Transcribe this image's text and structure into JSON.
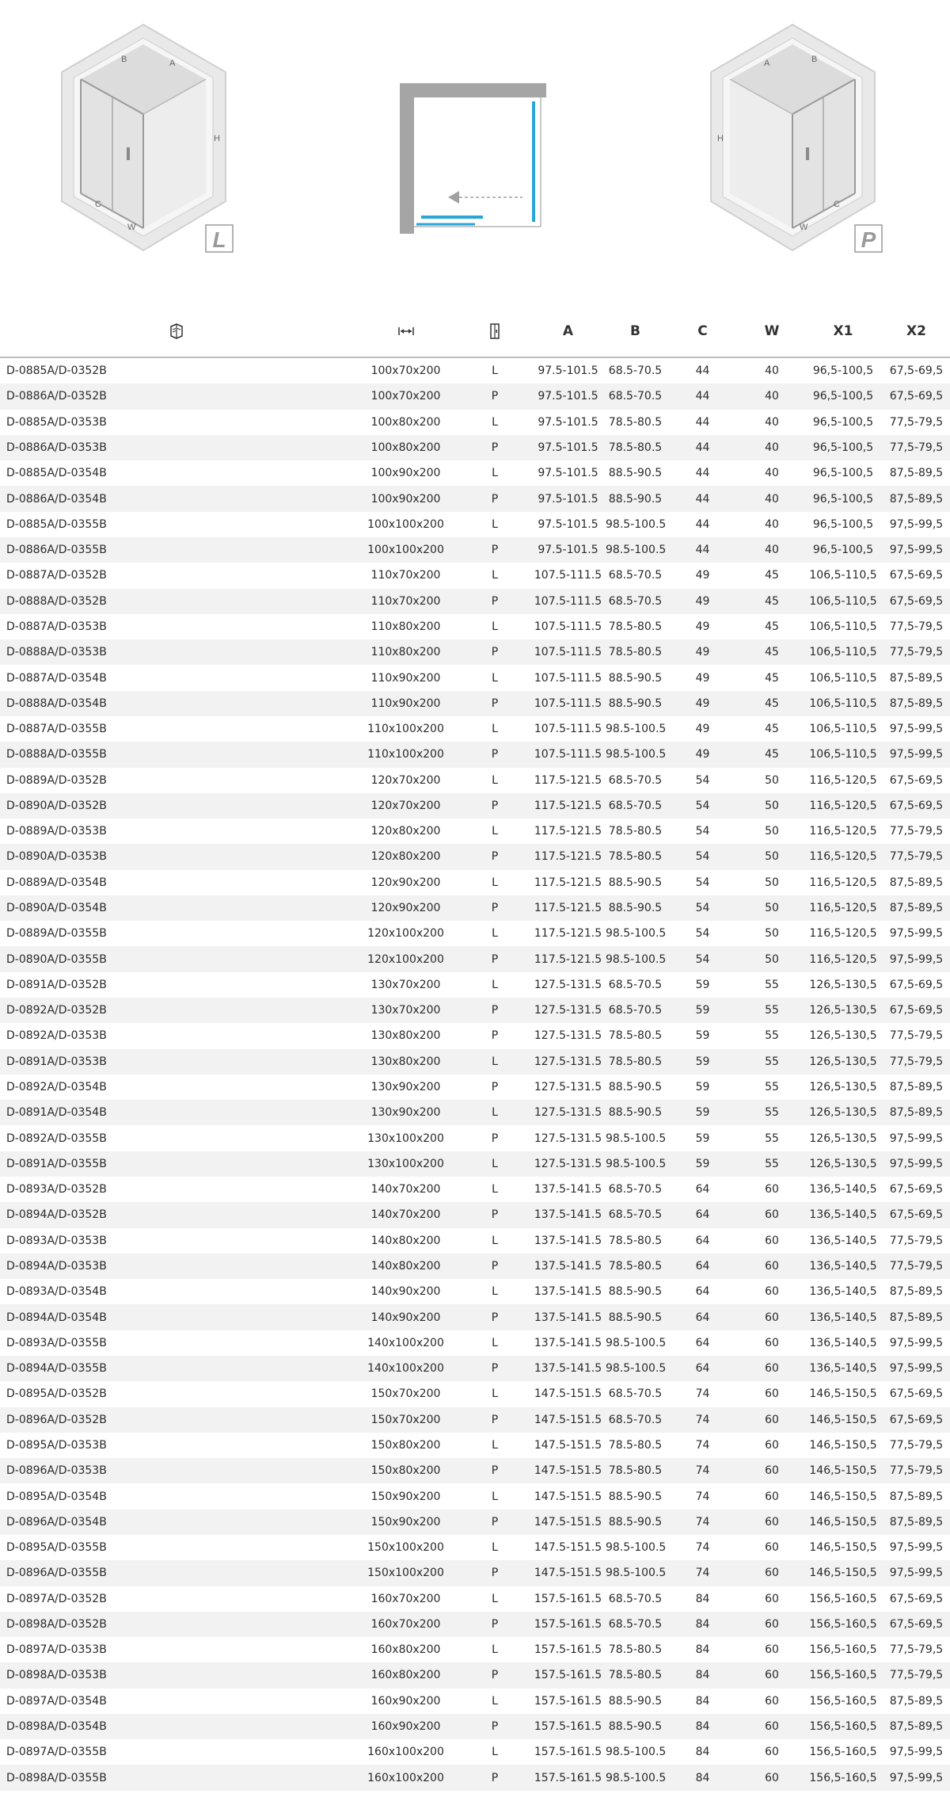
{
  "diagrams": {
    "left": {
      "letter": "L",
      "labels": {
        "a": "A",
        "b": "B",
        "c": "C",
        "w": "W",
        "h": "H"
      }
    },
    "right": {
      "letter": "P",
      "labels": {
        "a": "A",
        "b": "B",
        "c": "C",
        "w": "W",
        "h": "H"
      }
    }
  },
  "table": {
    "icons": {
      "code": "catalog-book-icon",
      "size": "width-arrows-icon",
      "side": "door-icon"
    },
    "headers": {
      "a": "A",
      "b": "B",
      "c": "C",
      "w": "W",
      "x1": "X1",
      "x2": "X2"
    },
    "rows": [
      [
        "D-0885A/D-0352B",
        "100x70x200",
        "L",
        "97.5-101.5",
        "68.5-70.5",
        "44",
        "40",
        "96,5-100,5",
        "67,5-69,5"
      ],
      [
        "D-0886A/D-0352B",
        "100x70x200",
        "P",
        "97.5-101.5",
        "68.5-70.5",
        "44",
        "40",
        "96,5-100,5",
        "67,5-69,5"
      ],
      [
        "D-0885A/D-0353B",
        "100x80x200",
        "L",
        "97.5-101.5",
        "78.5-80.5",
        "44",
        "40",
        "96,5-100,5",
        "77,5-79,5"
      ],
      [
        "D-0886A/D-0353B",
        "100x80x200",
        "P",
        "97.5-101.5",
        "78.5-80.5",
        "44",
        "40",
        "96,5-100,5",
        "77,5-79,5"
      ],
      [
        "D-0885A/D-0354B",
        "100x90x200",
        "L",
        "97.5-101.5",
        "88.5-90.5",
        "44",
        "40",
        "96,5-100,5",
        "87,5-89,5"
      ],
      [
        "D-0886A/D-0354B",
        "100x90x200",
        "P",
        "97.5-101.5",
        "88.5-90.5",
        "44",
        "40",
        "96,5-100,5",
        "87,5-89,5"
      ],
      [
        "D-0885A/D-0355B",
        "100x100x200",
        "L",
        "97.5-101.5",
        "98.5-100.5",
        "44",
        "40",
        "96,5-100,5",
        "97,5-99,5"
      ],
      [
        "D-0886A/D-0355B",
        "100x100x200",
        "P",
        "97.5-101.5",
        "98.5-100.5",
        "44",
        "40",
        "96,5-100,5",
        "97,5-99,5"
      ],
      [
        "D-0887A/D-0352B",
        "110x70x200",
        "L",
        "107.5-111.5",
        "68.5-70.5",
        "49",
        "45",
        "106,5-110,5",
        "67,5-69,5"
      ],
      [
        "D-0888A/D-0352B",
        "110x70x200",
        "P",
        "107.5-111.5",
        "68.5-70.5",
        "49",
        "45",
        "106,5-110,5",
        "67,5-69,5"
      ],
      [
        "D-0887A/D-0353B",
        "110x80x200",
        "L",
        "107.5-111.5",
        "78.5-80.5",
        "49",
        "45",
        "106,5-110,5",
        "77,5-79,5"
      ],
      [
        "D-0888A/D-0353B",
        "110x80x200",
        "P",
        "107.5-111.5",
        "78.5-80.5",
        "49",
        "45",
        "106,5-110,5",
        "77,5-79,5"
      ],
      [
        "D-0887A/D-0354B",
        "110x90x200",
        "L",
        "107.5-111.5",
        "88.5-90.5",
        "49",
        "45",
        "106,5-110,5",
        "87,5-89,5"
      ],
      [
        "D-0888A/D-0354B",
        "110x90x200",
        "P",
        "107.5-111.5",
        "88.5-90.5",
        "49",
        "45",
        "106,5-110,5",
        "87,5-89,5"
      ],
      [
        "D-0887A/D-0355B",
        "110x100x200",
        "L",
        "107.5-111.5",
        "98.5-100.5",
        "49",
        "45",
        "106,5-110,5",
        "97,5-99,5"
      ],
      [
        "D-0888A/D-0355B",
        "110x100x200",
        "P",
        "107.5-111.5",
        "98.5-100.5",
        "49",
        "45",
        "106,5-110,5",
        "97,5-99,5"
      ],
      [
        "D-0889A/D-0352B",
        "120x70x200",
        "L",
        "117.5-121.5",
        "68.5-70.5",
        "54",
        "50",
        "116,5-120,5",
        "67,5-69,5"
      ],
      [
        "D-0890A/D-0352B",
        "120x70x200",
        "P",
        "117.5-121.5",
        "68.5-70.5",
        "54",
        "50",
        "116,5-120,5",
        "67,5-69,5"
      ],
      [
        "D-0889A/D-0353B",
        "120x80x200",
        "L",
        "117.5-121.5",
        "78.5-80.5",
        "54",
        "50",
        "116,5-120,5",
        "77,5-79,5"
      ],
      [
        "D-0890A/D-0353B",
        "120x80x200",
        "P",
        "117.5-121.5",
        "78.5-80.5",
        "54",
        "50",
        "116,5-120,5",
        "77,5-79,5"
      ],
      [
        "D-0889A/D-0354B",
        "120x90x200",
        "L",
        "117.5-121.5",
        "88.5-90.5",
        "54",
        "50",
        "116,5-120,5",
        "87,5-89,5"
      ],
      [
        "D-0890A/D-0354B",
        "120x90x200",
        "P",
        "117.5-121.5",
        "88.5-90.5",
        "54",
        "50",
        "116,5-120,5",
        "87,5-89,5"
      ],
      [
        "D-0889A/D-0355B",
        "120x100x200",
        "L",
        "117.5-121.5",
        "98.5-100.5",
        "54",
        "50",
        "116,5-120,5",
        "97,5-99,5"
      ],
      [
        "D-0890A/D-0355B",
        "120x100x200",
        "P",
        "117.5-121.5",
        "98.5-100.5",
        "54",
        "50",
        "116,5-120,5",
        "97,5-99,5"
      ],
      [
        "D-0891A/D-0352B",
        "130x70x200",
        "L",
        "127.5-131.5",
        "68.5-70.5",
        "59",
        "55",
        "126,5-130,5",
        "67,5-69,5"
      ],
      [
        "D-0892A/D-0352B",
        "130x70x200",
        "P",
        "127.5-131.5",
        "68.5-70.5",
        "59",
        "55",
        "126,5-130,5",
        "67,5-69,5"
      ],
      [
        "D-0892A/D-0353B",
        "130x80x200",
        "P",
        "127.5-131.5",
        "78.5-80.5",
        "59",
        "55",
        "126,5-130,5",
        "77,5-79,5"
      ],
      [
        "D-0891A/D-0353B",
        "130x80x200",
        "L",
        "127.5-131.5",
        "78.5-80.5",
        "59",
        "55",
        "126,5-130,5",
        "77,5-79,5"
      ],
      [
        "D-0892A/D-0354B",
        "130x90x200",
        "P",
        "127.5-131.5",
        "88.5-90.5",
        "59",
        "55",
        "126,5-130,5",
        "87,5-89,5"
      ],
      [
        "D-0891A/D-0354B",
        "130x90x200",
        "L",
        "127.5-131.5",
        "88.5-90.5",
        "59",
        "55",
        "126,5-130,5",
        "87,5-89,5"
      ],
      [
        "D-0892A/D-0355B",
        "130x100x200",
        "P",
        "127.5-131.5",
        "98.5-100.5",
        "59",
        "55",
        "126,5-130,5",
        "97,5-99,5"
      ],
      [
        "D-0891A/D-0355B",
        "130x100x200",
        "L",
        "127.5-131.5",
        "98.5-100.5",
        "59",
        "55",
        "126,5-130,5",
        "97,5-99,5"
      ],
      [
        "D-0893A/D-0352B",
        "140x70x200",
        "L",
        "137.5-141.5",
        "68.5-70.5",
        "64",
        "60",
        "136,5-140,5",
        "67,5-69,5"
      ],
      [
        "D-0894A/D-0352B",
        "140x70x200",
        "P",
        "137.5-141.5",
        "68.5-70.5",
        "64",
        "60",
        "136,5-140,5",
        "67,5-69,5"
      ],
      [
        "D-0893A/D-0353B",
        "140x80x200",
        "L",
        "137.5-141.5",
        "78.5-80.5",
        "64",
        "60",
        "136,5-140,5",
        "77,5-79,5"
      ],
      [
        "D-0894A/D-0353B",
        "140x80x200",
        "P",
        "137.5-141.5",
        "78.5-80.5",
        "64",
        "60",
        "136,5-140,5",
        "77,5-79,5"
      ],
      [
        "D-0893A/D-0354B",
        "140x90x200",
        "L",
        "137.5-141.5",
        "88.5-90.5",
        "64",
        "60",
        "136,5-140,5",
        "87,5-89,5"
      ],
      [
        "D-0894A/D-0354B",
        "140x90x200",
        "P",
        "137.5-141.5",
        "88.5-90.5",
        "64",
        "60",
        "136,5-140,5",
        "87,5-89,5"
      ],
      [
        "D-0893A/D-0355B",
        "140x100x200",
        "L",
        "137.5-141.5",
        "98.5-100.5",
        "64",
        "60",
        "136,5-140,5",
        "97,5-99,5"
      ],
      [
        "D-0894A/D-0355B",
        "140x100x200",
        "P",
        "137.5-141.5",
        "98.5-100.5",
        "64",
        "60",
        "136,5-140,5",
        "97,5-99,5"
      ],
      [
        "D-0895A/D-0352B",
        "150x70x200",
        "L",
        "147.5-151.5",
        "68.5-70.5",
        "74",
        "60",
        "146,5-150,5",
        "67,5-69,5"
      ],
      [
        "D-0896A/D-0352B",
        "150x70x200",
        "P",
        "147.5-151.5",
        "68.5-70.5",
        "74",
        "60",
        "146,5-150,5",
        "67,5-69,5"
      ],
      [
        "D-0895A/D-0353B",
        "150x80x200",
        "L",
        "147.5-151.5",
        "78.5-80.5",
        "74",
        "60",
        "146,5-150,5",
        "77,5-79,5"
      ],
      [
        "D-0896A/D-0353B",
        "150x80x200",
        "P",
        "147.5-151.5",
        "78.5-80.5",
        "74",
        "60",
        "146,5-150,5",
        "77,5-79,5"
      ],
      [
        "D-0895A/D-0354B",
        "150x90x200",
        "L",
        "147.5-151.5",
        "88.5-90.5",
        "74",
        "60",
        "146,5-150,5",
        "87,5-89,5"
      ],
      [
        "D-0896A/D-0354B",
        "150x90x200",
        "P",
        "147.5-151.5",
        "88.5-90.5",
        "74",
        "60",
        "146,5-150,5",
        "87,5-89,5"
      ],
      [
        "D-0895A/D-0355B",
        "150x100x200",
        "L",
        "147.5-151.5",
        "98.5-100.5",
        "74",
        "60",
        "146,5-150,5",
        "97,5-99,5"
      ],
      [
        "D-0896A/D-0355B",
        "150x100x200",
        "P",
        "147.5-151.5",
        "98.5-100.5",
        "74",
        "60",
        "146,5-150,5",
        "97,5-99,5"
      ],
      [
        "D-0897A/D-0352B",
        "160x70x200",
        "L",
        "157.5-161.5",
        "68.5-70.5",
        "84",
        "60",
        "156,5-160,5",
        "67,5-69,5"
      ],
      [
        "D-0898A/D-0352B",
        "160x70x200",
        "P",
        "157.5-161.5",
        "68.5-70.5",
        "84",
        "60",
        "156,5-160,5",
        "67,5-69,5"
      ],
      [
        "D-0897A/D-0353B",
        "160x80x200",
        "L",
        "157.5-161.5",
        "78.5-80.5",
        "84",
        "60",
        "156,5-160,5",
        "77,5-79,5"
      ],
      [
        "D-0898A/D-0353B",
        "160x80x200",
        "P",
        "157.5-161.5",
        "78.5-80.5",
        "84",
        "60",
        "156,5-160,5",
        "77,5-79,5"
      ],
      [
        "D-0897A/D-0354B",
        "160x90x200",
        "L",
        "157.5-161.5",
        "88.5-90.5",
        "84",
        "60",
        "156,5-160,5",
        "87,5-89,5"
      ],
      [
        "D-0898A/D-0354B",
        "160x90x200",
        "P",
        "157.5-161.5",
        "88.5-90.5",
        "84",
        "60",
        "156,5-160,5",
        "87,5-89,5"
      ],
      [
        "D-0897A/D-0355B",
        "160x100x200",
        "L",
        "157.5-161.5",
        "98.5-100.5",
        "84",
        "60",
        "156,5-160,5",
        "97,5-99,5"
      ],
      [
        "D-0898A/D-0355B",
        "160x100x200",
        "P",
        "157.5-161.5",
        "98.5-100.5",
        "84",
        "60",
        "156,5-160,5",
        "97,5-99,5"
      ]
    ]
  }
}
